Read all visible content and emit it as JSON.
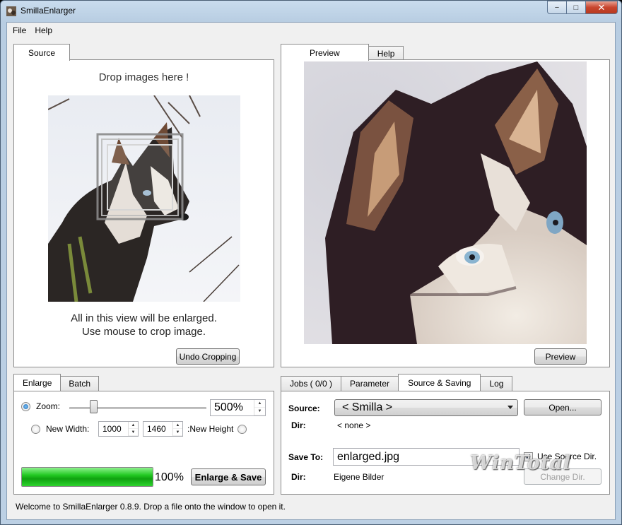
{
  "window": {
    "title": "SmillaEnlarger",
    "controls": {
      "minimize": "−",
      "maximize": "□",
      "close": "✕"
    }
  },
  "menu": {
    "items": [
      "File",
      "Help"
    ]
  },
  "source_panel": {
    "tab": "Source",
    "drop_hint": "Drop images here !",
    "caption_line1": "All in this view will be enlarged.",
    "caption_line2": "Use mouse to crop image.",
    "undo_button": "Undo Cropping"
  },
  "preview_panel": {
    "tabs": [
      "Preview",
      "Help"
    ],
    "preview_button": "Preview"
  },
  "enlarge_panel": {
    "tabs": [
      "Enlarge",
      "Batch"
    ],
    "zoom_label": "Zoom:",
    "zoom_value": "500%",
    "zoom_slider_fraction": 0.18,
    "new_width_label": "New Width:",
    "width_value": "1000",
    "height_value": "1460",
    "new_height_label": ":New Height",
    "progress_fraction": 1.0,
    "progress_label": "100%",
    "enlarge_button": "Enlarge & Save"
  },
  "saving_panel": {
    "tabs": [
      "Jobs ( 0/0 )",
      "Parameter",
      "Source & Saving",
      "Log"
    ],
    "source_label": "Source:",
    "source_value": "< Smilla >",
    "open_button": "Open...",
    "dir_label": "Dir:",
    "dir_value": "< none >",
    "save_to_label": "Save To:",
    "save_to_value": "enlarged.jpg",
    "use_source_dir_label": "Use Source Dir.",
    "use_source_dir_checked": true,
    "save_dir_label": "Dir:",
    "save_dir_value": "Eigene Bilder",
    "change_dir_button": "Change Dir."
  },
  "status": {
    "message": "Welcome to SmillaEnlarger 0.8.9.  Drop a file onto the window to open it."
  },
  "watermark": "WinTotal",
  "colors": {
    "progress": "#1fc21f",
    "active_tab": "#ffffff",
    "window_frame": "#bcd0e4"
  }
}
